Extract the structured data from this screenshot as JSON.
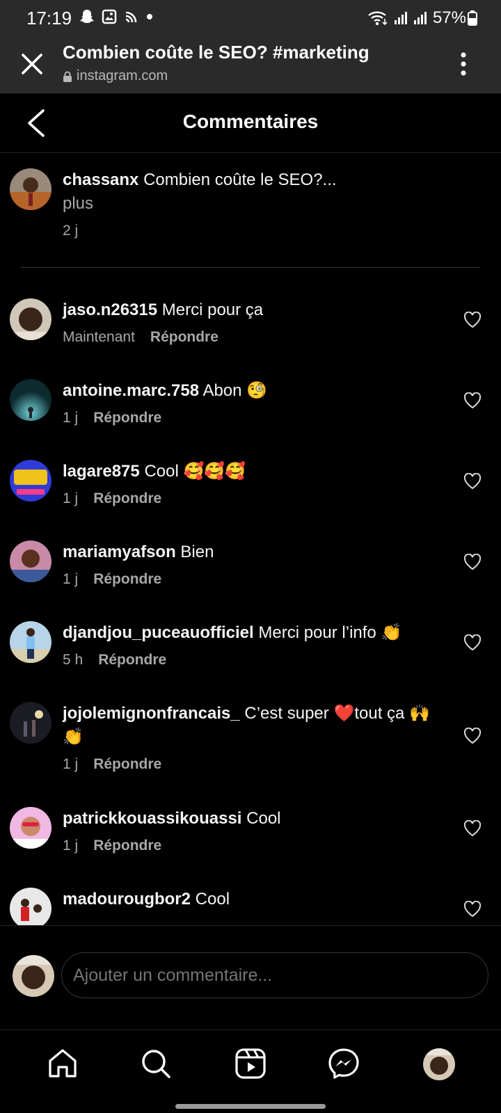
{
  "status_bar": {
    "time": "17:19",
    "battery": "57%"
  },
  "browser": {
    "title": "Combien coûte le SEO? #marketing",
    "url": "instagram.com"
  },
  "header": {
    "title": "Commentaires"
  },
  "caption": {
    "user": "chassanx",
    "text": "Combien coûte le SEO?...",
    "more": "plus",
    "time": "2 j"
  },
  "comments": [
    {
      "user": "jaso.n26315",
      "text": "Merci pour ça",
      "time": "Maintenant",
      "reply": "Répondre"
    },
    {
      "user": "antoine.marc.758",
      "text": "Abon 🧐",
      "time": "1 j",
      "reply": "Répondre"
    },
    {
      "user": "lagare875",
      "text": "Cool 🥰🥰🥰",
      "time": "1 j",
      "reply": "Répondre"
    },
    {
      "user": "mariamyafson",
      "text": "Bien",
      "time": "1 j",
      "reply": "Répondre"
    },
    {
      "user": "djandjou_puceauofficiel",
      "text": "Merci pour l’info 👏",
      "time": "5 h",
      "reply": "Répondre"
    },
    {
      "user": "jojolemignonfrancais_",
      "text": "C’est super ❤️tout ça 🙌👏",
      "time": "1 j",
      "reply": "Répondre"
    },
    {
      "user": "patrickkouassikouassi",
      "text": "Cool",
      "time": "1 j",
      "reply": "Répondre"
    },
    {
      "user": "madourougbor2",
      "text": "Cool",
      "time": "",
      "reply": ""
    }
  ],
  "composer": {
    "placeholder": "Ajouter un commentaire..."
  },
  "colors": {
    "background": "#000000",
    "chrome": "#2a2a2a",
    "secondary_text": "#a8a8a8",
    "heart_accent": "#ff3040"
  },
  "nav": {
    "items": [
      "home-icon",
      "search-icon",
      "reels-icon",
      "messenger-icon",
      "profile-avatar"
    ]
  }
}
